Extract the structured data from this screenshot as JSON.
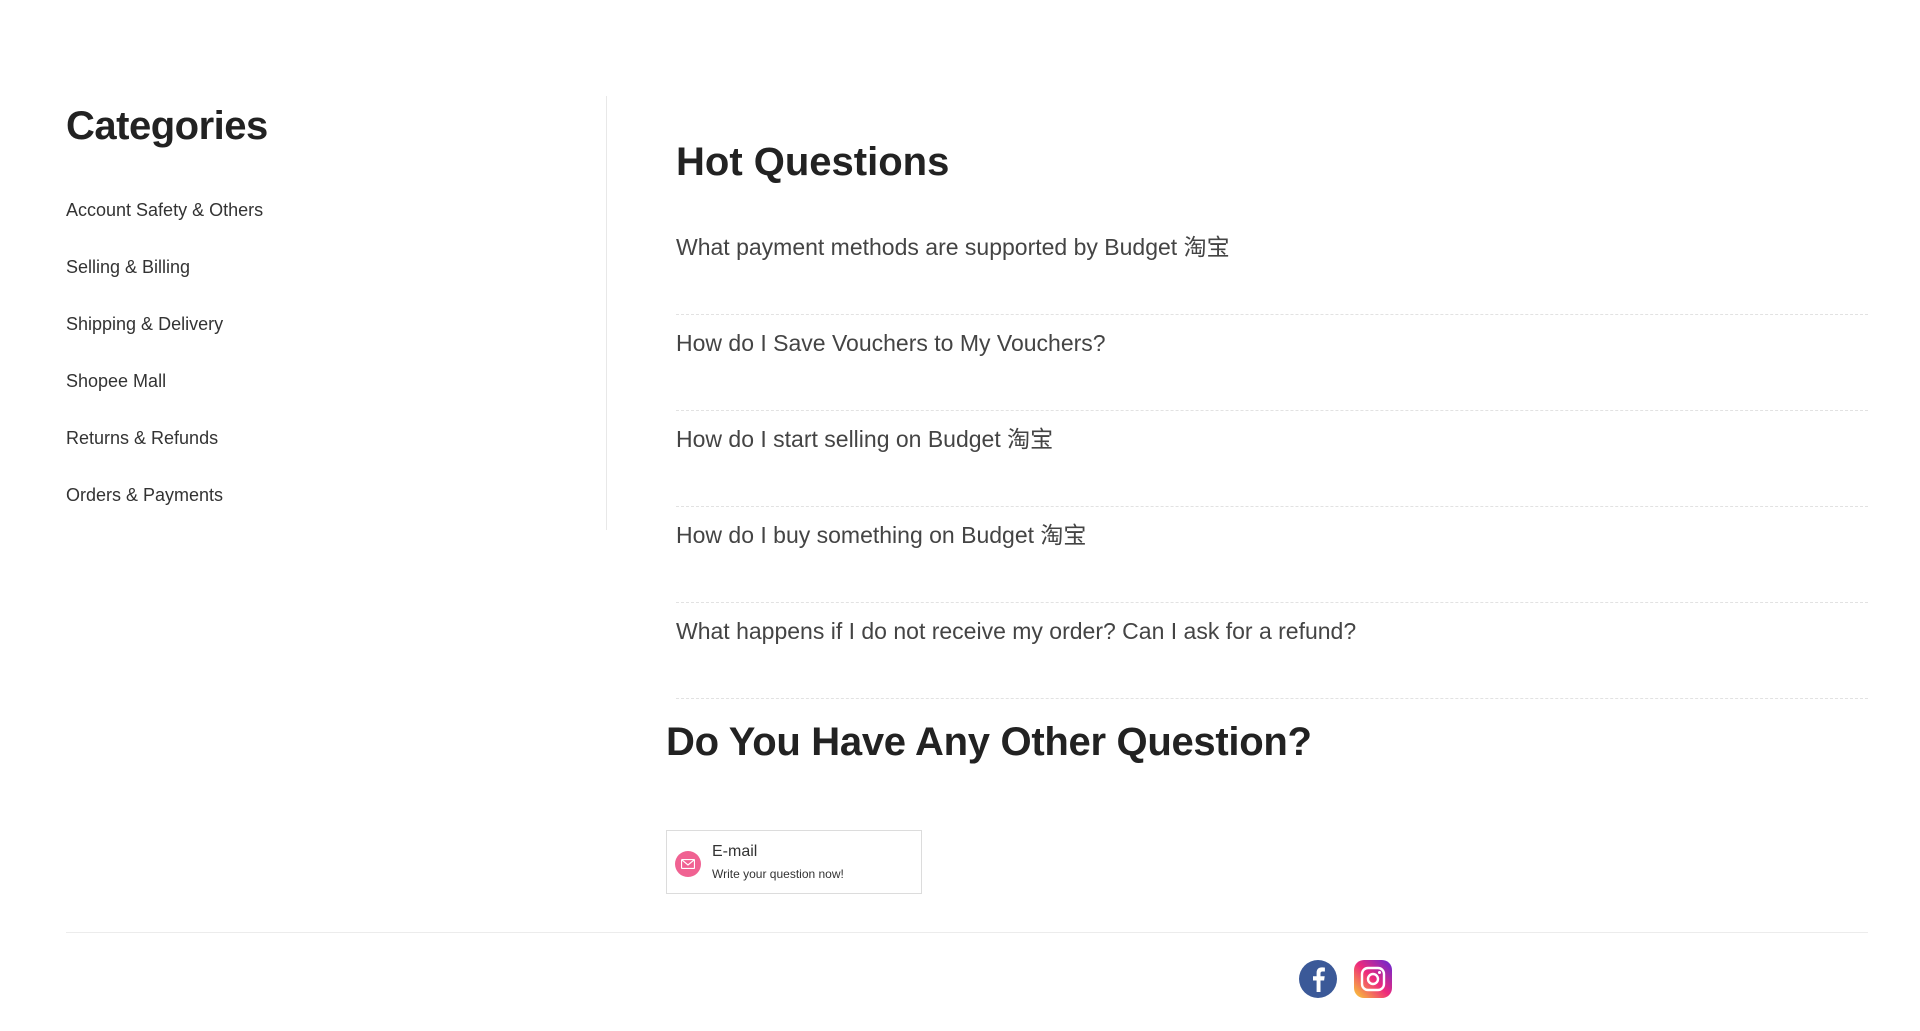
{
  "sidebar": {
    "title": "Categories",
    "items": [
      {
        "label": "Account Safety & Others"
      },
      {
        "label": "Selling & Billing"
      },
      {
        "label": "Shipping & Delivery"
      },
      {
        "label": "Shopee Mall"
      },
      {
        "label": "Returns & Refunds"
      },
      {
        "label": "Orders & Payments"
      }
    ]
  },
  "hot_questions": {
    "title": "Hot Questions",
    "items": [
      {
        "label": "What payment methods are supported by Budget 淘宝"
      },
      {
        "label": "How do I Save Vouchers to My Vouchers?"
      },
      {
        "label": "How do I start selling on Budget 淘宝"
      },
      {
        "label": "How do I buy something on Budget 淘宝"
      },
      {
        "label": "What happens if I do not receive my order? Can I ask for a refund?"
      }
    ]
  },
  "contact": {
    "title": "Do You Have Any Other Question?",
    "email_label": "E-mail",
    "email_sub": "Write your question now!",
    "icon": "mail-icon",
    "accent": "#f06292"
  },
  "footer": {
    "social": [
      {
        "icon": "facebook-icon",
        "color": "#3b5998"
      },
      {
        "icon": "instagram-icon",
        "color": "#e1306c"
      }
    ]
  }
}
